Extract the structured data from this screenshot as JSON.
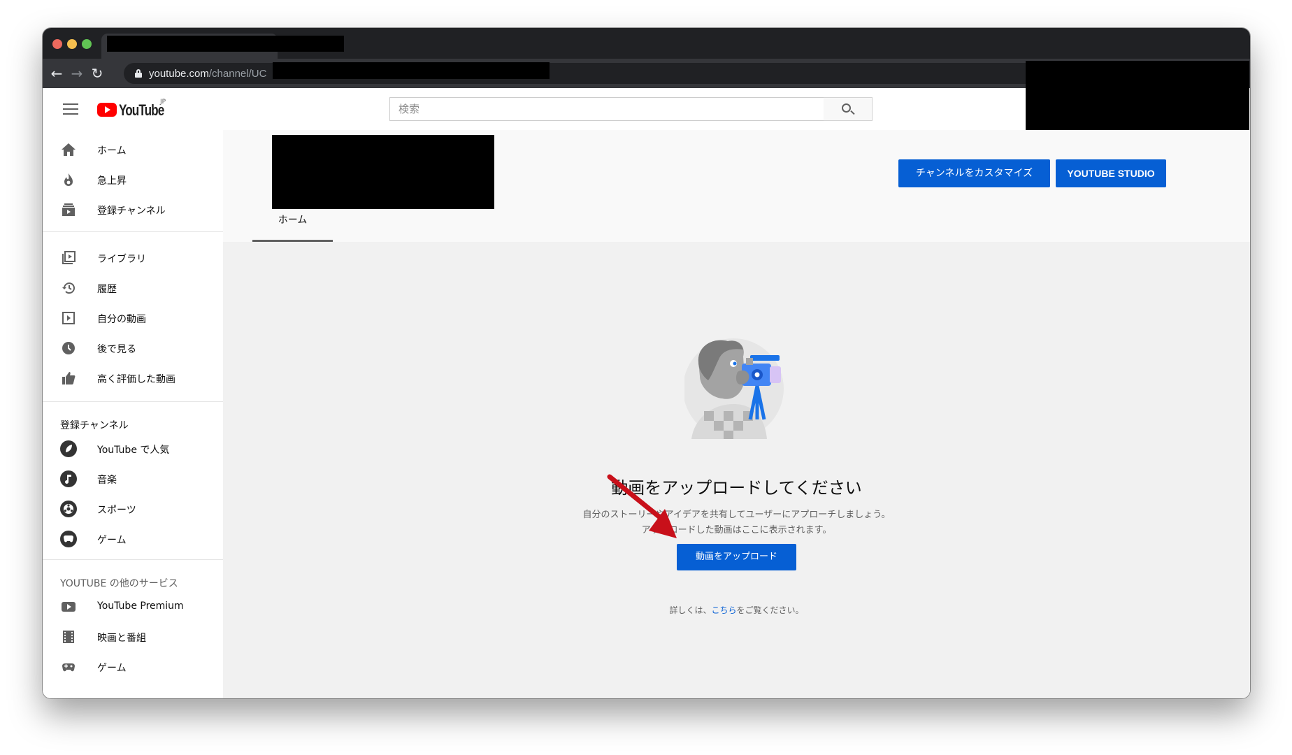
{
  "browser": {
    "url_host": "youtube.com",
    "url_path": "/channel/UC"
  },
  "masthead": {
    "logo_text": "YouTube",
    "logo_region": "JP",
    "search_placeholder": "検索"
  },
  "sidebar": {
    "primary": [
      {
        "label": "ホーム",
        "icon": "home-icon"
      },
      {
        "label": "急上昇",
        "icon": "flame-icon"
      },
      {
        "label": "登録チャンネル",
        "icon": "subscriptions-icon"
      }
    ],
    "library": [
      {
        "label": "ライブラリ",
        "icon": "library-icon"
      },
      {
        "label": "履歴",
        "icon": "history-icon"
      },
      {
        "label": "自分の動画",
        "icon": "my-videos-icon"
      },
      {
        "label": "後で見る",
        "icon": "watch-later-icon"
      },
      {
        "label": "高く評価した動画",
        "icon": "thumbs-up-icon"
      }
    ],
    "subscriptions_heading": "登録チャンネル",
    "subscriptions": [
      {
        "label": "YouTube で人気",
        "icon": "popular-icon"
      },
      {
        "label": "音楽",
        "icon": "music-icon"
      },
      {
        "label": "スポーツ",
        "icon": "sports-icon"
      },
      {
        "label": "ゲーム",
        "icon": "gaming-icon"
      }
    ],
    "more_heading": "YOUTUBE の他のサービス",
    "more": [
      {
        "label": "YouTube Premium",
        "icon": "premium-icon"
      },
      {
        "label": "映画と番組",
        "icon": "film-icon"
      },
      {
        "label": "ゲーム",
        "icon": "gaming-icon"
      }
    ]
  },
  "channel": {
    "customize_button": "チャンネルをカスタマイズ",
    "studio_button": "YOUTUBE STUDIO",
    "tabs": [
      {
        "label": "ホーム",
        "active": true
      }
    ]
  },
  "empty_state": {
    "title": "動画をアップロードしてください",
    "description_line1": "自分のストーリーやアイデアを共有してユーザーにアプローチしましょう。",
    "description_line2": "アップロードした動画はここに表示されます。",
    "upload_button": "動画をアップロード",
    "learn_prefix": "詳しくは、",
    "learn_link": "こちら",
    "learn_suffix": "をご覧ください。"
  },
  "colors": {
    "brand_red": "#ff0000",
    "button_blue": "#065fd4",
    "annotation_arrow": "#c8101a"
  }
}
